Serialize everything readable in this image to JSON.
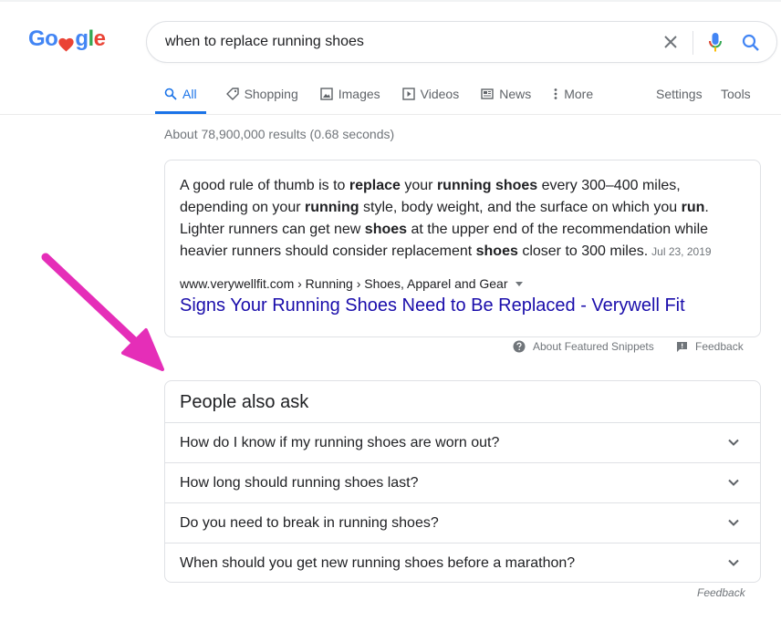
{
  "logo": {
    "part1": "Go",
    "part2": "gle"
  },
  "search": {
    "query": "when to replace running shoes"
  },
  "tabs": [
    {
      "label": "All"
    },
    {
      "label": "Shopping"
    },
    {
      "label": "Images"
    },
    {
      "label": "Videos"
    },
    {
      "label": "News"
    },
    {
      "label": "More"
    }
  ],
  "tools": {
    "settings": "Settings",
    "tools": "Tools"
  },
  "stats": "About 78,900,000 results (0.68 seconds)",
  "snippet": {
    "segments": [
      {
        "t": "A good rule of thumb is to ",
        "b": false
      },
      {
        "t": "replace",
        "b": true
      },
      {
        "t": " your ",
        "b": false
      },
      {
        "t": "running shoes",
        "b": true
      },
      {
        "t": " every 300–400 miles, depending on your ",
        "b": false
      },
      {
        "t": "running",
        "b": true
      },
      {
        "t": " style, body weight, and the surface on which you ",
        "b": false
      },
      {
        "t": "run",
        "b": true
      },
      {
        "t": ". Lighter runners can get new ",
        "b": false
      },
      {
        "t": "shoes",
        "b": true
      },
      {
        "t": " at the upper end of the recommendation while heavier runners should consider replacement ",
        "b": false
      },
      {
        "t": "shoes",
        "b": true
      },
      {
        "t": " closer to 300 miles.",
        "b": false
      }
    ],
    "date": "Jul 23, 2019",
    "cite": "www.verywellfit.com › Running › Shoes, Apparel and Gear",
    "title": "Signs Your Running Shoes Need to Be Replaced - Verywell Fit"
  },
  "snippet_footer": {
    "about": "About Featured Snippets",
    "feedback": "Feedback"
  },
  "paa": {
    "heading": "People also ask",
    "questions": [
      "How do I know if my running shoes are worn out?",
      "How long should running shoes last?",
      "Do you need to break in running shoes?",
      "When should you get new running shoes before a marathon?"
    ]
  },
  "feedback_bottom": "Feedback",
  "colors": {
    "accent": "#1a73e8",
    "link": "#1a0dab",
    "arrow": "#e52eb8",
    "heart": "#ea4335"
  },
  "icons": [
    "search-icon",
    "tag-icon",
    "image-icon",
    "play-icon",
    "newspaper-icon",
    "more-vert-icon",
    "close-icon",
    "mic-icon",
    "help-icon",
    "feedback-icon",
    "chevron-down-icon",
    "heart-icon",
    "arrow-icon"
  ]
}
